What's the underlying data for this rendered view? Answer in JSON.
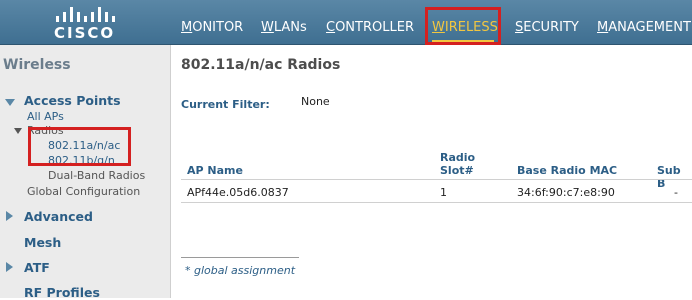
{
  "brand": {
    "name": "CISCO"
  },
  "nav": {
    "items": [
      "MONITOR",
      "WLANs",
      "CONTROLLER",
      "WIRELESS",
      "SECURITY",
      "MANAGEMENT"
    ],
    "active": "WIRELESS"
  },
  "sidebar": {
    "title": "Wireless",
    "access_points": {
      "label": "Access Points",
      "all_aps": "All APs",
      "radios": "Radios",
      "radio_80211a": "802.11a/n/ac",
      "radio_80211b": "802.11b/g/n",
      "dual_band": "Dual-Band Radios",
      "global_config": "Global Configuration"
    },
    "advanced": "Advanced",
    "mesh": "Mesh",
    "atf": "ATF",
    "rf_profiles": "RF Profiles"
  },
  "main": {
    "title": "802.11a/n/ac Radios",
    "filter_label": "Current Filter:",
    "filter_value": "None",
    "table": {
      "headers": {
        "ap_name": "AP Name",
        "radio_slot_1": "Radio",
        "radio_slot_2": "Slot#",
        "base_mac": "Base Radio MAC",
        "sub_band": "Sub B"
      },
      "rows": [
        {
          "ap_name": "APf44e.05d6.0837",
          "radio_slot": "1",
          "base_mac": "34:6f:90:c7:e8:90",
          "sub_band": "-"
        }
      ]
    },
    "footnote": "* global assignment"
  },
  "colors": {
    "header_bg": "#4a7a9b",
    "active_nav": "#f2c640",
    "highlight_box": "#d42020",
    "link": "#2c5e86"
  }
}
